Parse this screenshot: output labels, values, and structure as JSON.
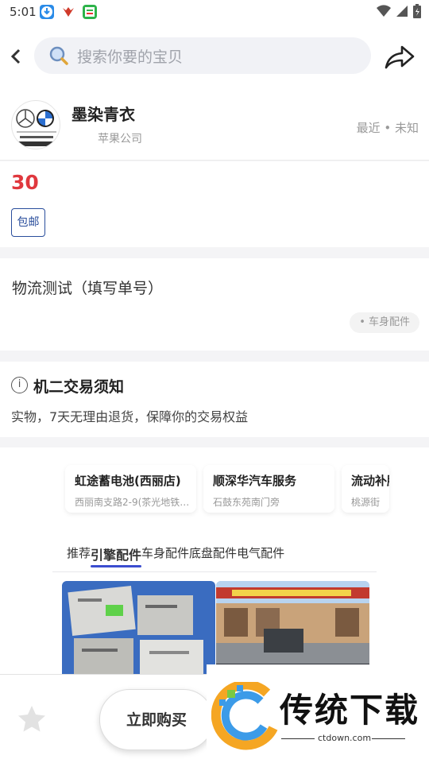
{
  "status": {
    "time": "5:01"
  },
  "header": {
    "search_placeholder": "搜索你要的宝贝"
  },
  "seller": {
    "name": "墨染青衣",
    "subtitle": "苹果公司",
    "meta": "最近 • 未知"
  },
  "product": {
    "price": "30",
    "tag": "包邮",
    "description": "物流测试（填写单号）",
    "category": "• 车身配件"
  },
  "notice": {
    "icon": "i",
    "title": "机二交易须知",
    "text": "实物，7天无理由退货，保障你的交易权益"
  },
  "recommend": {
    "shops": [
      {
        "name": "虹途蓄电池(西丽店)",
        "address": "西丽南支路2-9(茶光地铁…"
      },
      {
        "name": "顺深华汽车服务",
        "address": "石鼓东苑南门旁"
      },
      {
        "name": "流动补胎",
        "address": "桃源街"
      }
    ],
    "tabs": [
      "推荐",
      "引擎配件",
      "车身配件",
      "底盘配件",
      "电气配件"
    ]
  },
  "bottom": {
    "buy_label": "立即购买"
  },
  "watermark": {
    "title": "传统下载",
    "url": "ctdown.com"
  },
  "colors": {
    "price": "#e0383e",
    "tag": "#2a4e9c",
    "tab_underline": "#3b4dcf"
  }
}
